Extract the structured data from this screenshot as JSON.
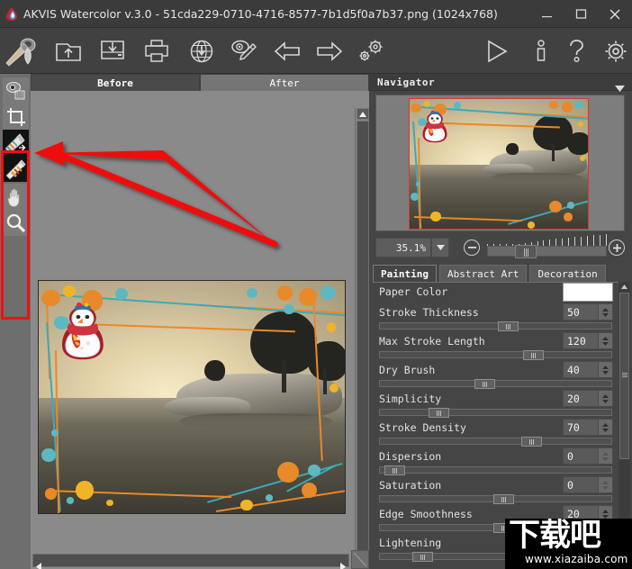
{
  "window": {
    "title": "AKVIS Watercolor v.3.0 - 51cda229-0710-4716-8577-7b1d5f0a7b37.png (1024x768)",
    "logo_icon": "akvis-flame-logo-icon",
    "minimize_label": "—",
    "maximize_label": "❐",
    "close_label": "✕",
    "bg_color": "#3b3b3b"
  },
  "toolbar": {
    "items": [
      {
        "name": "brush-logo-icon",
        "tooltip": "AKVIS Watercolor"
      },
      {
        "name": "open-image-icon",
        "tooltip": "Open Image"
      },
      {
        "name": "save-image-icon",
        "tooltip": "Save Image"
      },
      {
        "name": "print-image-icon",
        "tooltip": "Print Image"
      },
      {
        "name": "publish-web-icon",
        "tooltip": "Publish Image"
      },
      {
        "name": "add-text-stamp-icon",
        "tooltip": "Text / Watermark"
      },
      {
        "name": "undo-arrow-icon",
        "tooltip": "Undo"
      },
      {
        "name": "redo-arrow-icon",
        "tooltip": "Redo"
      },
      {
        "name": "batch-presets-icon",
        "tooltip": "Batch Processing"
      },
      {
        "name": "run-process-icon",
        "tooltip": "Run"
      },
      {
        "name": "about-info-icon",
        "tooltip": "About"
      },
      {
        "name": "help-question-icon",
        "tooltip": "Help"
      },
      {
        "name": "preferences-gear-icon",
        "tooltip": "Preferences"
      }
    ]
  },
  "toolstrip": {
    "highlight_color": "#ee1111",
    "tools": [
      {
        "name": "quick-preview-tool",
        "label": "Quick Preview",
        "state": "normal"
      },
      {
        "name": "crop-tool",
        "label": "Crop",
        "state": "normal"
      },
      {
        "name": "history-brush-tool",
        "label": "History Brush",
        "state": "dark"
      },
      {
        "name": "eraser-pencil-tool",
        "label": "Eraser",
        "state": "dark"
      },
      {
        "name": "hand-tool",
        "label": "Hand",
        "state": "normal"
      },
      {
        "name": "zoom-tool",
        "label": "Zoom",
        "state": "normal"
      }
    ]
  },
  "canvas": {
    "tabs": [
      {
        "label": "Before",
        "active": true
      },
      {
        "label": "After",
        "active": false
      }
    ],
    "scroll_up_icon": "scroll-up-arrow-icon",
    "scroll_down_icon": "scroll-down-arrow-icon",
    "scroll_left_icon": "scroll-left-arrow-icon",
    "scroll_right_icon": "scroll-right-arrow-icon",
    "resize_corner_icon": "resize-grip-icon"
  },
  "navigator": {
    "title": "Navigator",
    "collapse_icon": "chevron-down-icon",
    "viewport_color": "#d23b2e",
    "zoom": {
      "value": "35.1%",
      "dropdown_icon": "chevron-down-icon",
      "minus_label": "–",
      "plus_label": "+",
      "slider_position_pct": 26
    }
  },
  "settings": {
    "tabs": [
      {
        "label": "Painting",
        "active": true
      },
      {
        "label": "Abstract Art",
        "active": false
      },
      {
        "label": "Decoration",
        "active": false
      }
    ],
    "parameters": [
      {
        "name": "paper-color",
        "label": "Paper Color",
        "type": "color",
        "color": "#ffffff"
      },
      {
        "name": "stroke-thickness",
        "label": "Stroke Thickness",
        "type": "slider",
        "value": "50",
        "pos_pct": 51,
        "enabled": true
      },
      {
        "name": "max-stroke-length",
        "label": "Max Stroke Length",
        "type": "slider",
        "value": "120",
        "pos_pct": 62,
        "enabled": true
      },
      {
        "name": "dry-brush",
        "label": "Dry Brush",
        "type": "slider",
        "value": "40",
        "pos_pct": 41,
        "enabled": true
      },
      {
        "name": "simplicity",
        "label": "Simplicity",
        "type": "slider",
        "value": "20",
        "pos_pct": 21,
        "enabled": true
      },
      {
        "name": "stroke-density",
        "label": "Stroke Density",
        "type": "slider",
        "value": "70",
        "pos_pct": 62,
        "enabled": true
      },
      {
        "name": "dispersion",
        "label": "Dispersion",
        "type": "slider",
        "value": "0",
        "pos_pct": 3,
        "enabled": false
      },
      {
        "name": "saturation",
        "label": "Saturation",
        "type": "slider",
        "value": "0",
        "pos_pct": 50,
        "enabled": false
      },
      {
        "name": "edge-smoothness",
        "label": "Edge Smoothness",
        "type": "slider",
        "value": "20",
        "pos_pct": 49,
        "enabled": true
      },
      {
        "name": "lightening",
        "label": "Lightening",
        "type": "slider",
        "value": "",
        "pos_pct": 14,
        "enabled": true
      }
    ]
  },
  "annotation": {
    "arrow_color": "#ee1111",
    "description": "red arrow pointing at history brush and eraser tools"
  },
  "watermark": {
    "text_cn": "下载吧",
    "url": "www.xiazaiba.com"
  },
  "image_preview": {
    "description": "sepia toned lake landscape with rocky island and trees, snowman sticker overlay, orange/teal/yellow decorative dots and lines"
  }
}
